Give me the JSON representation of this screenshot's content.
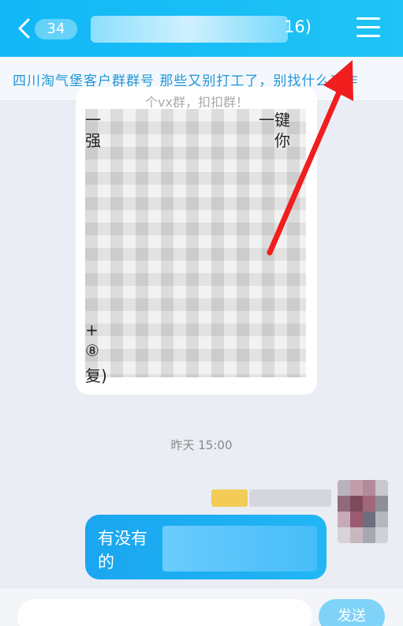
{
  "header": {
    "unread_count": "34",
    "title_suffix": "16)"
  },
  "notice": {
    "text": "四川淘气堡客户群群号 那些又别打工了，别找什么工作"
  },
  "message_left": {
    "fragments": [
      "一",
      "一键",
      "强",
      "你",
      "⑧",
      "复)",
      "+"
    ],
    "partial_text": "个vx群，扣扣群！"
  },
  "timestamp": "昨天 15:00",
  "message_right": {
    "line1": "有没有",
    "line2": "的"
  },
  "input": {
    "placeholder": "",
    "send_label": "发送"
  },
  "colors": {
    "header": "#12b8f6",
    "bubble_right": "#1aa6f0",
    "annotation_arrow": "#f01e1e"
  }
}
